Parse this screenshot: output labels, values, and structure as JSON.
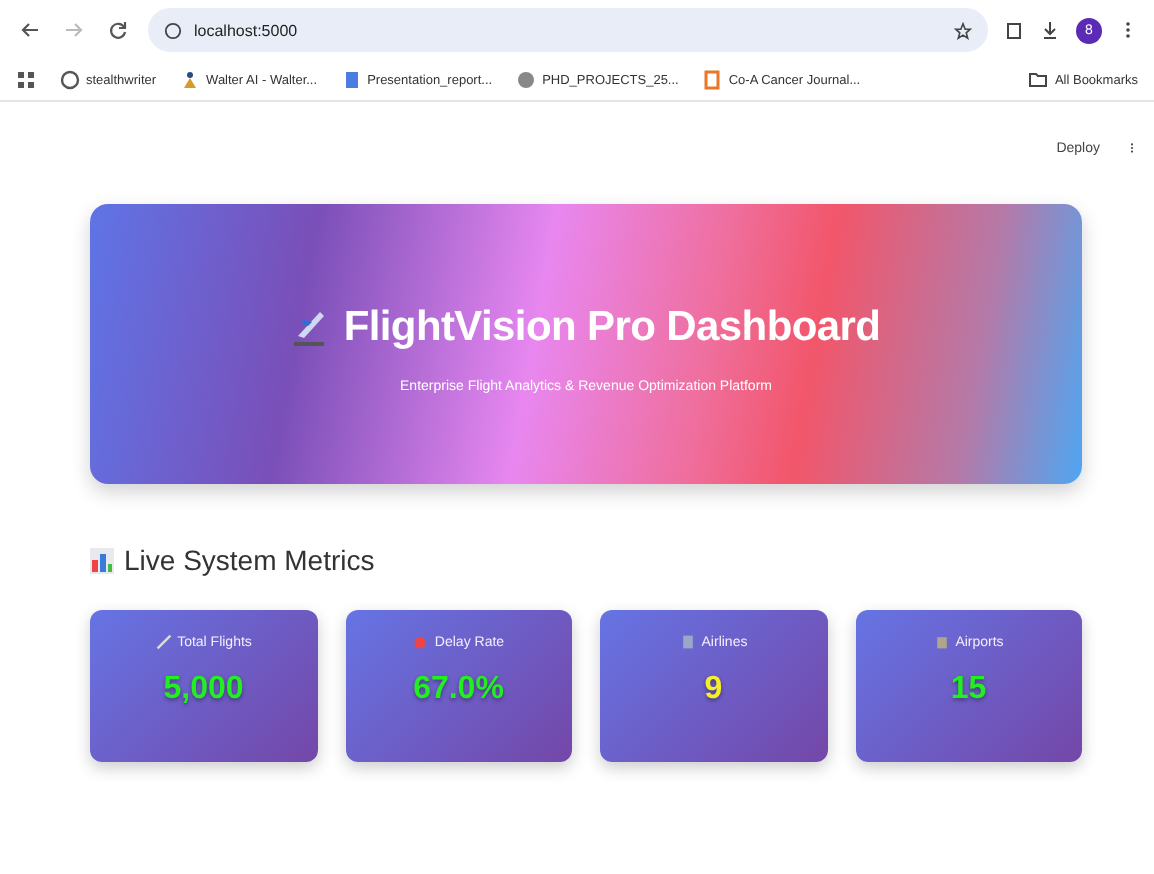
{
  "browser": {
    "url": "localhost:5000",
    "bookmarks": [
      "stealthwriter",
      "Walter AI - Walter...",
      "Presentation_report...",
      "PHD_PROJECTS_25...",
      "Co-A Cancer Journal..."
    ],
    "all_bookmarks": "All Bookmarks",
    "profile": "8"
  },
  "app_header": {
    "deploy": "Deploy"
  },
  "hero": {
    "title": "FlightVision Pro Dashboard",
    "subtitle": "Enterprise Flight Analytics & Revenue Optimization Platform"
  },
  "metrics_section": {
    "title": "Live System Metrics",
    "metrics": [
      {
        "label": "Total Flights",
        "value": "5,000",
        "color": "#22ee22"
      },
      {
        "label": "Delay Rate",
        "value": "67.0%",
        "color": "#22ee22"
      },
      {
        "label": "Airlines",
        "value": "9",
        "color": "#f5ee2a"
      },
      {
        "label": "Airports",
        "value": "15",
        "color": "#22ee22"
      }
    ]
  }
}
